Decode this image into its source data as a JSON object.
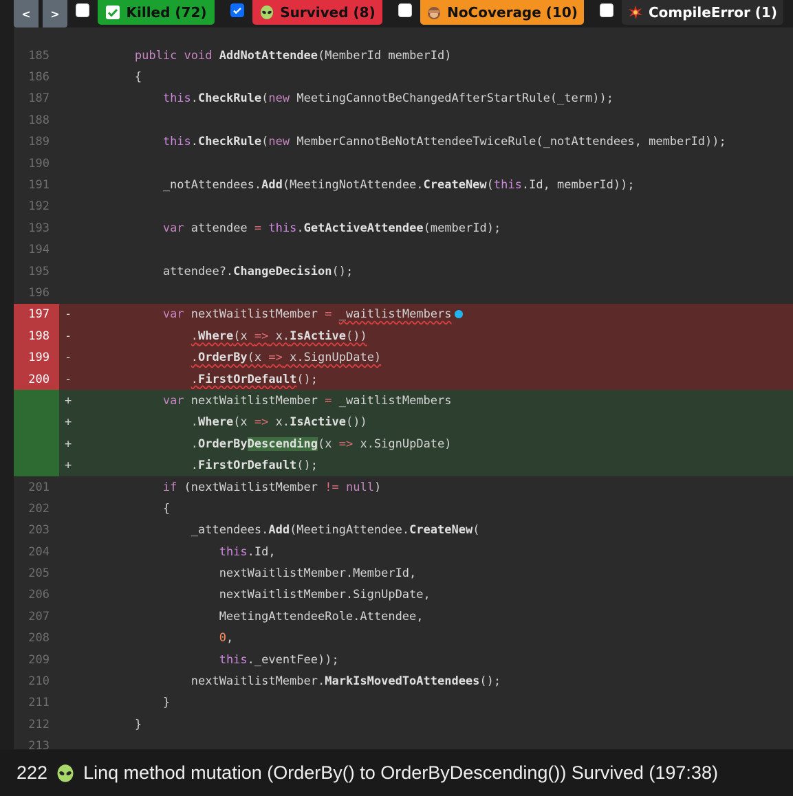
{
  "toolbar": {
    "prev_label": "<",
    "next_label": ">",
    "filters": [
      {
        "label": "Killed (72)",
        "checked": false,
        "color": "#1aa12f",
        "icon": "check-icon"
      },
      {
        "label": "Survived (8)",
        "checked": true,
        "color": "#e0303f",
        "icon": "alien-icon"
      },
      {
        "label": "NoCoverage (10)",
        "checked": false,
        "color": "#f39121",
        "icon": "see-no-evil-icon"
      },
      {
        "label": "CompileError (1)",
        "checked": false,
        "color": "#2c2c2c",
        "icon": "explosion-icon"
      }
    ]
  },
  "code": {
    "partial_top_line": "184",
    "partial_bottom_line": "213",
    "lines": [
      {
        "n": "185",
        "text": "        public void AddNotAttendee(MemberId memberId)"
      },
      {
        "n": "186",
        "text": "        {"
      },
      {
        "n": "187",
        "text": "            this.CheckRule(new MeetingCannotBeChangedAfterStartRule(_term));"
      },
      {
        "n": "188",
        "text": ""
      },
      {
        "n": "189",
        "text": "            this.CheckRule(new MemberCannotBeNotAttendeeTwiceRule(_notAttendees, memberId));"
      },
      {
        "n": "190",
        "text": ""
      },
      {
        "n": "191",
        "text": "            _notAttendees.Add(MeetingNotAttendee.CreateNew(this.Id, memberId));"
      },
      {
        "n": "192",
        "text": ""
      },
      {
        "n": "193",
        "text": "            var attendee = this.GetActiveAttendee(memberId);"
      },
      {
        "n": "194",
        "text": ""
      },
      {
        "n": "195",
        "text": "            attendee?.ChangeDecision();"
      },
      {
        "n": "196",
        "text": ""
      },
      {
        "n": "197",
        "kind": "removed",
        "text": "            var nextWaitlistMember = _waitlistMembers"
      },
      {
        "n": "198",
        "kind": "removed",
        "text": "                .Where(x => x.IsActive())"
      },
      {
        "n": "199",
        "kind": "removed",
        "text": "                .OrderBy(x => x.SignUpDate)"
      },
      {
        "n": "200",
        "kind": "removed",
        "text": "                .FirstOrDefault();"
      },
      {
        "n": "",
        "kind": "added",
        "text": "            var nextWaitlistMember = _waitlistMembers"
      },
      {
        "n": "",
        "kind": "added",
        "text": "                .Where(x => x.IsActive())"
      },
      {
        "n": "",
        "kind": "added",
        "text": "                .OrderByDescending(x => x.SignUpDate)"
      },
      {
        "n": "",
        "kind": "added",
        "text": "                .FirstOrDefault();"
      },
      {
        "n": "201",
        "text": "            if (nextWaitlistMember != null)"
      },
      {
        "n": "202",
        "text": "            {"
      },
      {
        "n": "203",
        "text": "                _attendees.Add(MeetingAttendee.CreateNew("
      },
      {
        "n": "204",
        "text": "                    this.Id,"
      },
      {
        "n": "205",
        "text": "                    nextWaitlistMember.MemberId,"
      },
      {
        "n": "206",
        "text": "                    nextWaitlistMember.SignUpDate,"
      },
      {
        "n": "207",
        "text": "                    MeetingAttendeeRole.Attendee,"
      },
      {
        "n": "208",
        "text": "                    0,"
      },
      {
        "n": "209",
        "text": "                    this._eventFee));"
      },
      {
        "n": "210",
        "text": "                nextWaitlistMember.MarkIsMovedToAttendees();"
      },
      {
        "n": "211",
        "text": "            }"
      },
      {
        "n": "212",
        "text": "        }"
      }
    ]
  },
  "status": {
    "id": "222",
    "icon": "alien-icon",
    "text": "Linq method mutation (OrderBy() to OrderByDescending()) Survived (197:38)"
  }
}
